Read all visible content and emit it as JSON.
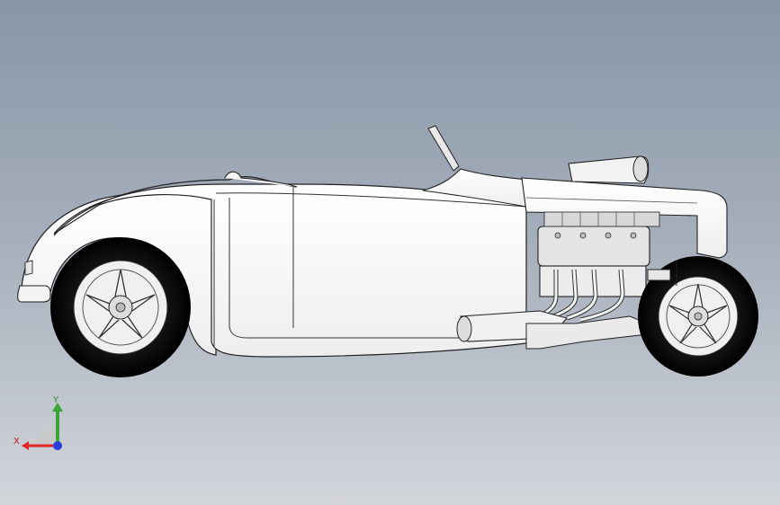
{
  "viewport": {
    "model": "hot-rod-roadster",
    "view": "right-side",
    "background_top": "#8896a8",
    "background_bottom": "#d2d5da"
  },
  "triad": {
    "x_label": "X",
    "y_label": "Y",
    "x_color": "#e0242a",
    "y_color": "#3aa635",
    "z_color": "#2a3fd8"
  }
}
